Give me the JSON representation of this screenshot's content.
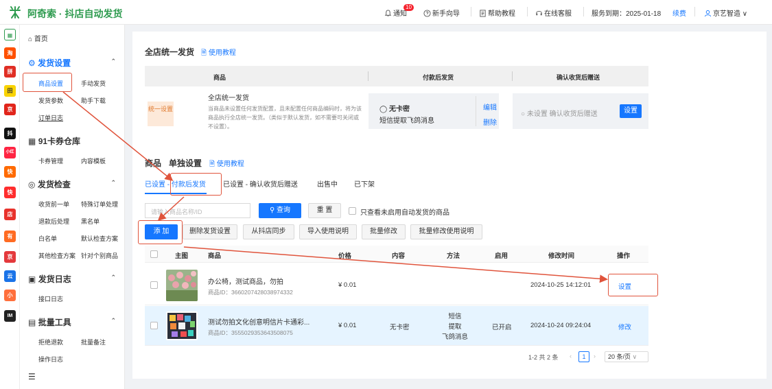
{
  "app": {
    "title": "阿奇索 · 抖店自动发货"
  },
  "topnav": {
    "notify_label": "通知",
    "notify_count": "10",
    "guide_label": "新手向导",
    "help_label": "帮助教程",
    "service_label": "在线客服",
    "expire_label": "服务到期：2025-01-18",
    "renew_label": "续费",
    "user_label": "京艺智造"
  },
  "rail": {
    "items": [
      "淘",
      "拼",
      "田",
      "京",
      "抖",
      "小红书",
      "快",
      "快",
      "店",
      "有",
      "京",
      "云",
      "小",
      "IM"
    ]
  },
  "sidebar": {
    "home": "首页",
    "sections": [
      {
        "title": "发货设置",
        "items": [
          "商品设置",
          "手动发货",
          "发货参数",
          "助手下载",
          "订单日志"
        ]
      },
      {
        "title": "91卡券仓库",
        "items": [
          "卡券管理",
          "内容模板"
        ]
      },
      {
        "title": "发货检查",
        "items": [
          "收货前一单",
          "特殊订单处理",
          "退款后处理",
          "黑名单",
          "白名单",
          "默认检查方案",
          "其他检查方案",
          "针对个别商品"
        ]
      },
      {
        "title": "发货日志",
        "items": [
          "接口日志"
        ]
      },
      {
        "title": "批量工具",
        "items": [
          "拒绝退款",
          "批量备注",
          "操作日志"
        ]
      }
    ],
    "collapse_icon": "menu-collapse-icon"
  },
  "global_section": {
    "title": "全店统一发货",
    "help_link": "使用教程",
    "columns": [
      "商品",
      "付款后发货",
      "确认收货后赠送"
    ],
    "tag": "统一设置",
    "name": "全店统一发货",
    "desc": "当商品未设置任何发货配置，且未配置任何商品编码时，将为该商品执行全店统一发货。（类似于默认发货，如不需要可关闭或不设置）。",
    "mode": "无卡密",
    "mode_sub": "短信提取飞鸽消息",
    "edit": "编辑",
    "delete": "删除",
    "confirm_radio": "未设置 确认收货后赠送",
    "set_button": "设置"
  },
  "product_section": {
    "title": "商品",
    "title2": "单独设置",
    "help_link": "使用教程",
    "tabs": [
      "已设置 - 付款后发货",
      "已设置 - 确认收货后赠送",
      "出售中",
      "已下架"
    ],
    "search_placeholder": "请输入商品名称/ID",
    "search_button": "查询",
    "reset_button": "重 置",
    "only_unset_label": "只查看未启用自动发货的商品",
    "actions": [
      "添 加",
      "删除发货设置",
      "从抖店同步",
      "导入使用说明",
      "批量修改",
      "批量修改使用说明"
    ],
    "columns": [
      "主图",
      "商品",
      "价格",
      "内容",
      "方法",
      "启用",
      "修改时间",
      "操作"
    ],
    "rows": [
      {
        "name": "办公椅，测试商品，勿拍",
        "id": "商品ID：3660207428038974332",
        "price": "¥ 0.01",
        "content": "",
        "method": [
          "",
          "",
          ""
        ],
        "enabled": "",
        "mtime": "2024-10-25 14:12:01",
        "op": "设置"
      },
      {
        "name": "测试勿拍文化创意明信片卡通彩...",
        "id": "商品ID：3555029353643508075",
        "price": "¥ 0.01",
        "content": "无卡密",
        "method": [
          "短信",
          "提取",
          "飞鸽消息"
        ],
        "enabled": "已开启",
        "mtime": "2024-10-24 09:24:04",
        "op": "修改"
      }
    ],
    "pager": {
      "summary": "1-2 共 2 条",
      "page": "1",
      "page_size": "20 条/页"
    }
  },
  "colors": {
    "brand": "#2e9b4f",
    "accent": "#1677ff",
    "annotation": "#e0533b"
  }
}
